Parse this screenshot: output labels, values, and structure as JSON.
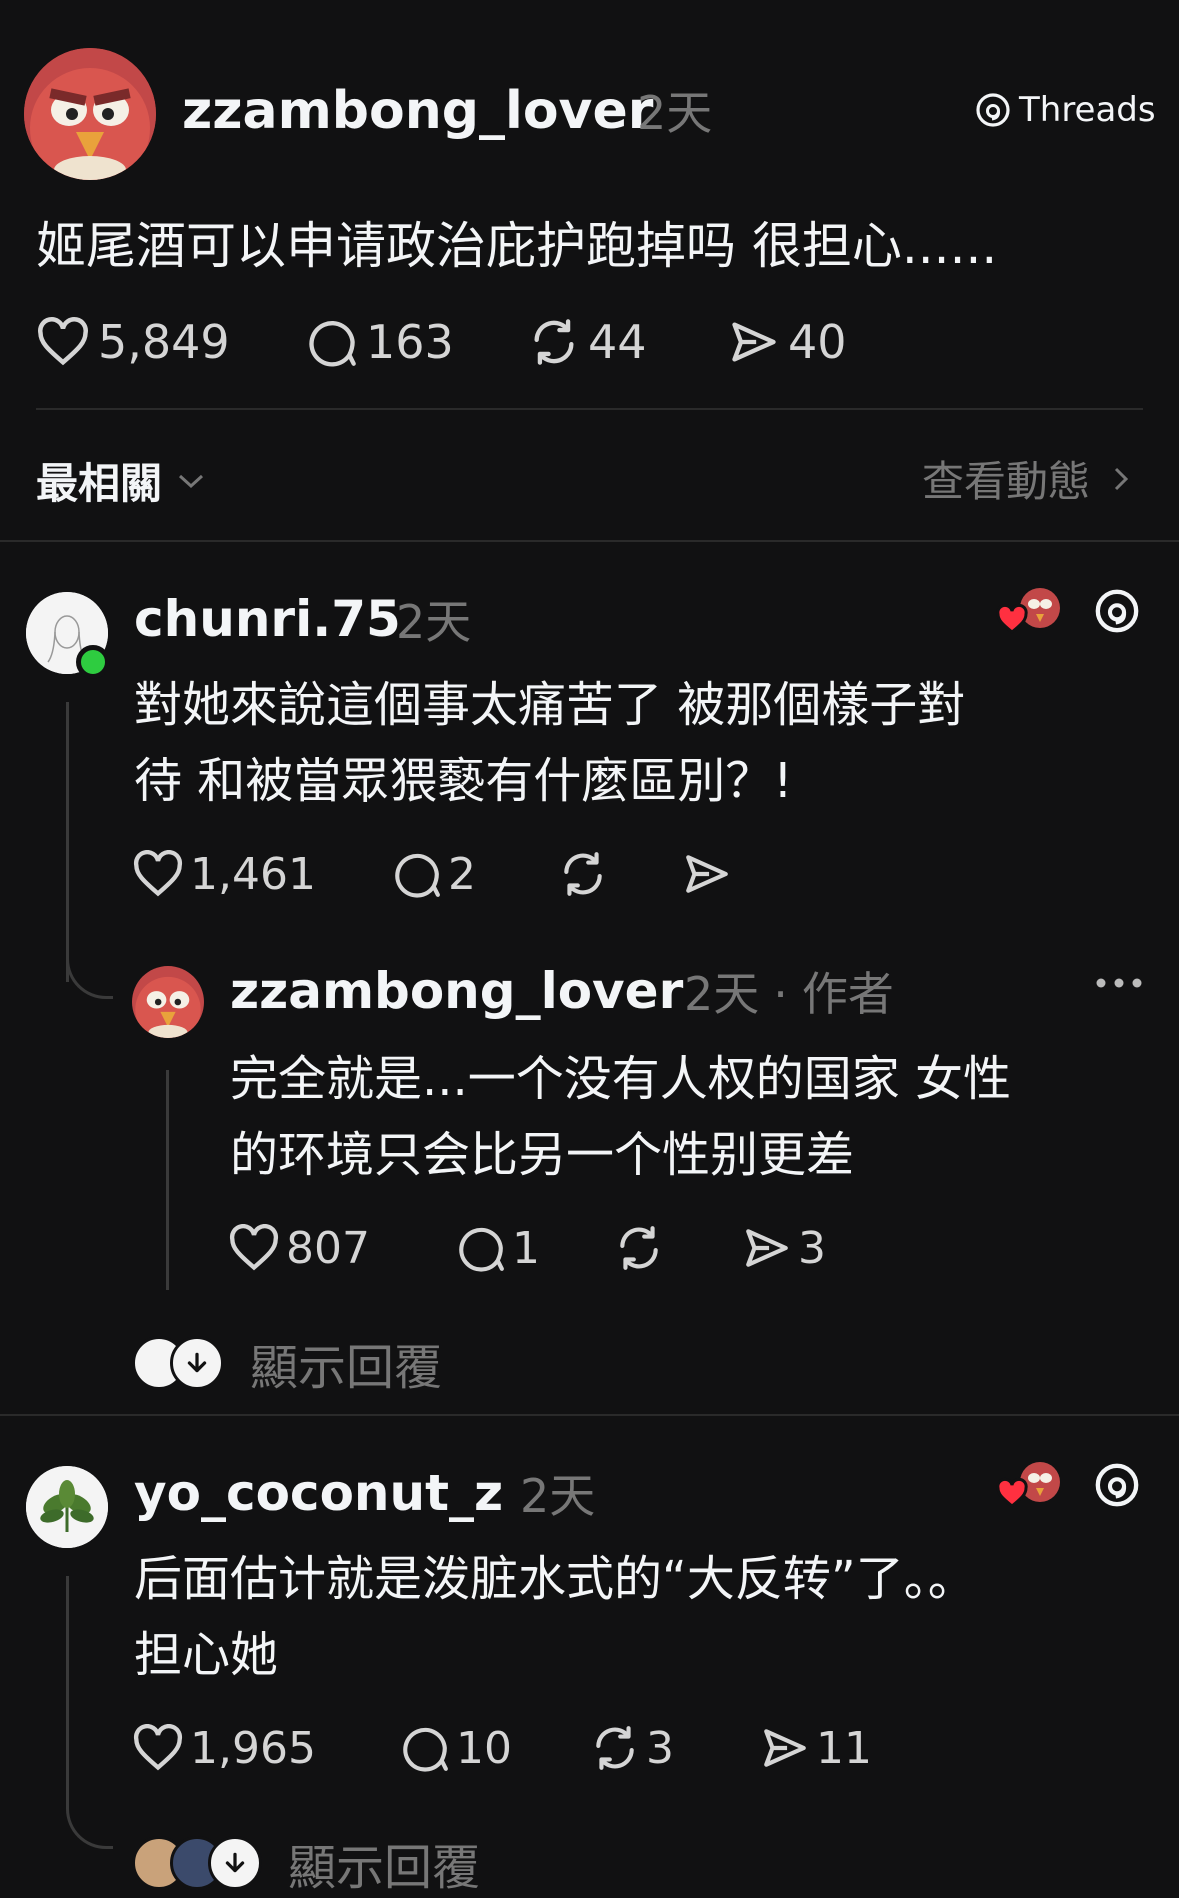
{
  "brand": {
    "icon": "threads-logo-icon",
    "label": "Threads"
  },
  "post": {
    "username": "zzambong_lover",
    "time": "2天",
    "text": "姬尾酒可以申请政治庇护跑掉吗 很担心......",
    "likes": "5,849",
    "comments": "163",
    "reposts": "44",
    "shares": "40"
  },
  "sort": {
    "label": "最相關",
    "activity_link": "查看動態"
  },
  "replies": [
    {
      "username": "chunri.75",
      "time": "2天",
      "text_line1": "對她來說這個事太痛苦了  被那個樣子對",
      "text_line2": "待 和被當眾猥褻有什麼區別？!",
      "likes": "1,461",
      "comments": "2",
      "reposts": "",
      "shares": "",
      "online": true,
      "sub_reply": {
        "username": "zzambong_lover",
        "time": "2天",
        "author_label": "作者",
        "text_line1": "完全就是...一个没有人权的国家 女性",
        "text_line2": "的环境只会比另一个性别更差",
        "likes": "807",
        "comments": "1",
        "reposts": "",
        "shares": "3"
      },
      "show_replies": "顯示回覆"
    },
    {
      "username": "yo_coconut_z",
      "time": "2天",
      "text_line1": "后面估计就是泼脏水式的“大反转”了。。",
      "text_line2": "担心她",
      "likes": "1,965",
      "comments": "10",
      "reposts": "3",
      "shares": "11",
      "show_replies": "顯示回覆"
    }
  ],
  "colors": {
    "background": "#111112",
    "text": "#f3f5f7",
    "muted": "#777777",
    "heart_red": "#ff3040",
    "online_green": "#2ecc40"
  }
}
